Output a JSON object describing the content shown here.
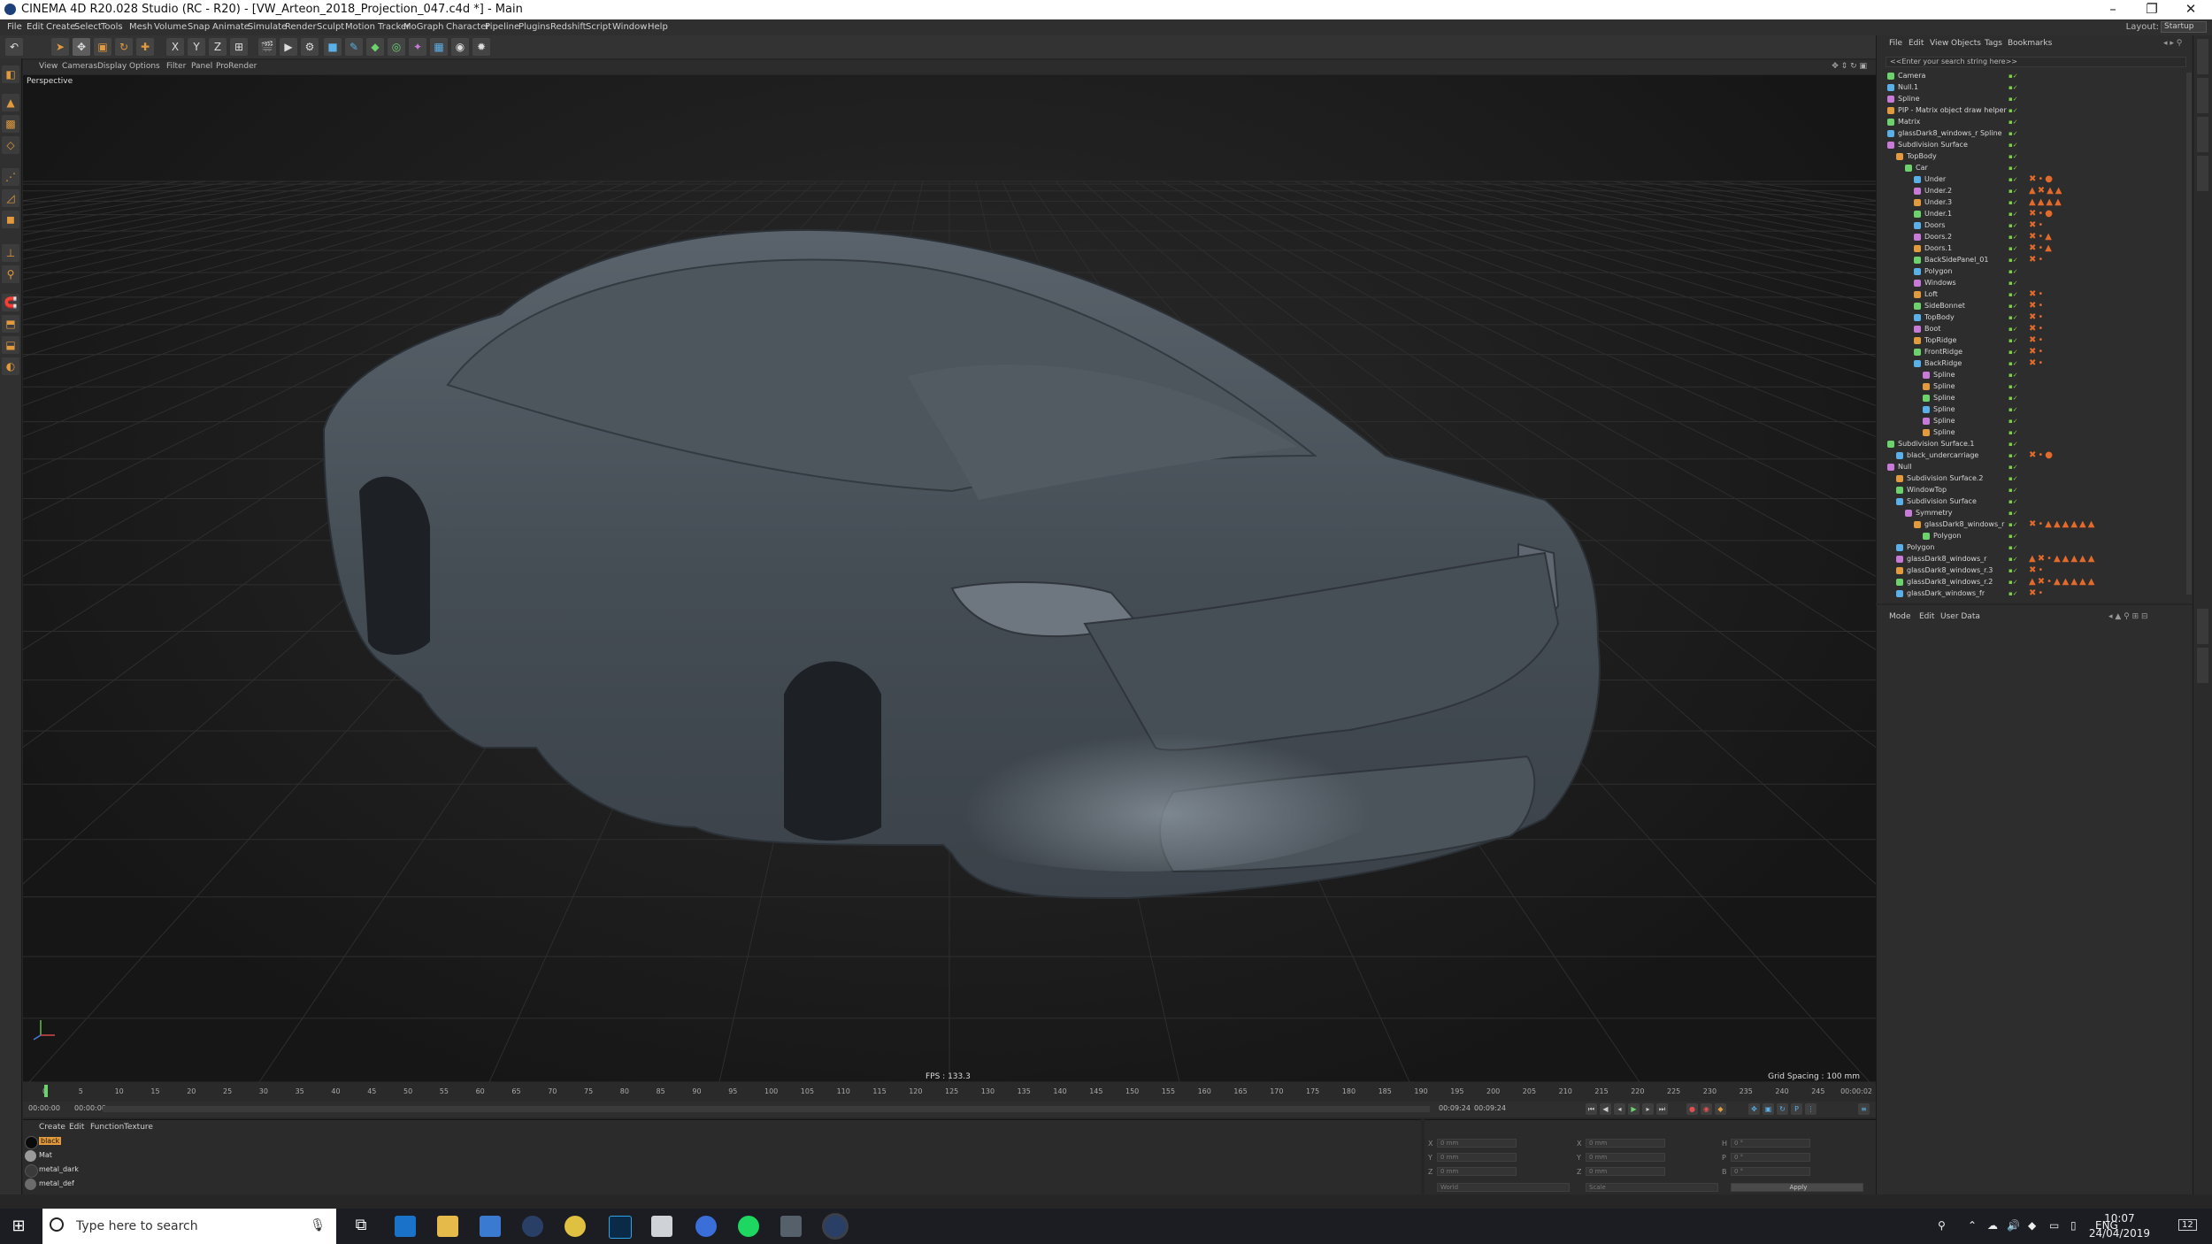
{
  "window": {
    "title": "CINEMA 4D R20.028 Studio (RC - R20) - [VW_Arteon_2018_Projection_047.c4d *] - Main",
    "minimize": "–",
    "restore": "❐",
    "close": "✕"
  },
  "menu": {
    "items": [
      "File",
      "Edit",
      "Create",
      "Select",
      "Tools",
      "Mesh",
      "Volume",
      "Snap",
      "Animate",
      "Simulate",
      "Render",
      "Sculpt",
      "Motion Tracker",
      "MoGraph",
      "Character",
      "Pipeline",
      "Plugins",
      "Redshift",
      "Script",
      "Window",
      "Help"
    ],
    "layout_label": "Layout:",
    "layout_value": "Startup"
  },
  "toolbar": {
    "axis_x": "X",
    "axis_y": "Y",
    "axis_z": "Z"
  },
  "viewport": {
    "menu": [
      "View",
      "Cameras",
      "Display",
      "Options",
      "Filter",
      "Panel",
      "ProRender"
    ],
    "camera_label": "Perspective",
    "fps": "FPS : 133.3",
    "grid_spacing": "Grid Spacing : 100 mm"
  },
  "timeline": {
    "ticks": [
      "0",
      "5",
      "10",
      "15",
      "20",
      "25",
      "30",
      "35",
      "40",
      "45",
      "50",
      "55",
      "60",
      "65",
      "70",
      "75",
      "80",
      "85",
      "90",
      "95",
      "100",
      "105",
      "110",
      "115",
      "120",
      "125",
      "130",
      "135",
      "140",
      "145",
      "150",
      "155",
      "160",
      "165",
      "170",
      "175",
      "180",
      "185",
      "190",
      "195",
      "200",
      "205",
      "210",
      "215",
      "220",
      "225",
      "230",
      "235",
      "240",
      "245"
    ],
    "end_frame": "0 F",
    "frame_display": "00:00:02",
    "start_time": "00:00:00",
    "current_time": "00:00:00",
    "end_time_a": "00:09:24",
    "end_time_b": "00:09:24"
  },
  "materials": {
    "tabs": [
      "Create",
      "Edit",
      "Function",
      "Texture"
    ],
    "items": [
      {
        "name": "black",
        "color": "#0a0a0a",
        "selected": true
      },
      {
        "name": "Mat",
        "color": "#9a9a9a",
        "selected": false
      },
      {
        "name": "metal_dark",
        "color": "#3a3a3a",
        "selected": false
      },
      {
        "name": "metal_def",
        "color": "#6b6b6b",
        "selected": false
      }
    ]
  },
  "coordinates": {
    "labels": [
      "X",
      "Y",
      "Z",
      "X",
      "Y",
      "Z",
      "H",
      "P",
      "B"
    ],
    "values": [
      "0 mm",
      "0 mm",
      "0 mm",
      "0 mm",
      "0 mm",
      "0 mm",
      "0 °",
      "0 °",
      "0 °"
    ],
    "mode1": "World",
    "mode2": "Scale",
    "apply": "Apply"
  },
  "object_manager": {
    "menu": [
      "File",
      "Edit",
      "View",
      "Objects",
      "Tags",
      "Bookmarks"
    ],
    "search_placeholder": "<<Enter your search string here>>",
    "objects": [
      {
        "name": "Camera",
        "indent": 0,
        "tags": ""
      },
      {
        "name": "Null.1",
        "indent": 0,
        "tags": ""
      },
      {
        "name": "Spline",
        "indent": 0,
        "tags": ""
      },
      {
        "name": "PIP - Matrix object draw helper",
        "indent": 0,
        "tags": ""
      },
      {
        "name": "Matrix",
        "indent": 0,
        "tags": ""
      },
      {
        "name": "glassDark8_windows_r Spline",
        "indent": 0,
        "tags": ""
      },
      {
        "name": "Subdivision Surface",
        "indent": 0,
        "tags": ""
      },
      {
        "name": "TopBody",
        "indent": 1,
        "tags": ""
      },
      {
        "name": "Car",
        "indent": 2,
        "tags": ""
      },
      {
        "name": "Under",
        "indent": 3,
        "tags": "✖•●"
      },
      {
        "name": "Under.2",
        "indent": 3,
        "tags": "▲✖▲▲"
      },
      {
        "name": "Under.3",
        "indent": 3,
        "tags": "▲▲▲▲"
      },
      {
        "name": "Under.1",
        "indent": 3,
        "tags": "✖•●"
      },
      {
        "name": "Doors",
        "indent": 3,
        "tags": "✖•"
      },
      {
        "name": "Doors.2",
        "indent": 3,
        "tags": "✖•▲"
      },
      {
        "name": "Doors.1",
        "indent": 3,
        "tags": "✖•▲"
      },
      {
        "name": "BackSidePanel_01",
        "indent": 3,
        "tags": "✖•"
      },
      {
        "name": "Polygon",
        "indent": 3,
        "tags": ""
      },
      {
        "name": "Windows",
        "indent": 3,
        "tags": ""
      },
      {
        "name": "Loft",
        "indent": 3,
        "tags": "✖•"
      },
      {
        "name": "SideBonnet",
        "indent": 3,
        "tags": "✖•"
      },
      {
        "name": "TopBody",
        "indent": 3,
        "tags": "✖•"
      },
      {
        "name": "Boot",
        "indent": 3,
        "tags": "✖•"
      },
      {
        "name": "TopRidge",
        "indent": 3,
        "tags": "✖•"
      },
      {
        "name": "FrontRidge",
        "indent": 3,
        "tags": "✖•"
      },
      {
        "name": "BackRidge",
        "indent": 3,
        "tags": "✖•"
      },
      {
        "name": "Spline",
        "indent": 4,
        "tags": ""
      },
      {
        "name": "Spline",
        "indent": 4,
        "tags": ""
      },
      {
        "name": "Spline",
        "indent": 4,
        "tags": ""
      },
      {
        "name": "Spline",
        "indent": 4,
        "tags": ""
      },
      {
        "name": "Spline",
        "indent": 4,
        "tags": ""
      },
      {
        "name": "Spline",
        "indent": 4,
        "tags": ""
      },
      {
        "name": "Subdivision Surface.1",
        "indent": 0,
        "tags": ""
      },
      {
        "name": "black_undercarriage",
        "indent": 1,
        "tags": "✖•●"
      },
      {
        "name": "Null",
        "indent": 0,
        "tags": ""
      },
      {
        "name": "Subdivision Surface.2",
        "indent": 1,
        "tags": ""
      },
      {
        "name": "WindowTop",
        "indent": 1,
        "tags": ""
      },
      {
        "name": "Subdivision Surface",
        "indent": 1,
        "tags": ""
      },
      {
        "name": "Symmetry",
        "indent": 2,
        "tags": ""
      },
      {
        "name": "glassDark8_windows_r",
        "indent": 3,
        "tags": "✖•▲▲▲▲▲▲"
      },
      {
        "name": "Polygon",
        "indent": 4,
        "tags": ""
      },
      {
        "name": "Polygon",
        "indent": 1,
        "tags": ""
      },
      {
        "name": "glassDark8_windows_r",
        "indent": 1,
        "tags": "▲✖•▲▲▲▲▲"
      },
      {
        "name": "glassDark8_windows_r.3",
        "indent": 1,
        "tags": "✖•"
      },
      {
        "name": "glassDark8_windows_r.2",
        "indent": 1,
        "tags": "▲✖•▲▲▲▲▲"
      },
      {
        "name": "glassDark_windows_fr",
        "indent": 1,
        "tags": "✖•"
      }
    ]
  },
  "attribute_manager": {
    "menu": [
      "Mode",
      "Edit",
      "User Data"
    ]
  },
  "taskbar": {
    "search_placeholder": "Type here to search",
    "language": "ENG",
    "time": "10:07",
    "date": "24/04/2019",
    "notifications": "12"
  },
  "colors": {
    "accent_orange": "#e29a3c",
    "tag_orange": "#e36a2a",
    "check_green": "#7fcf4a",
    "car_body": "#4a525a"
  }
}
